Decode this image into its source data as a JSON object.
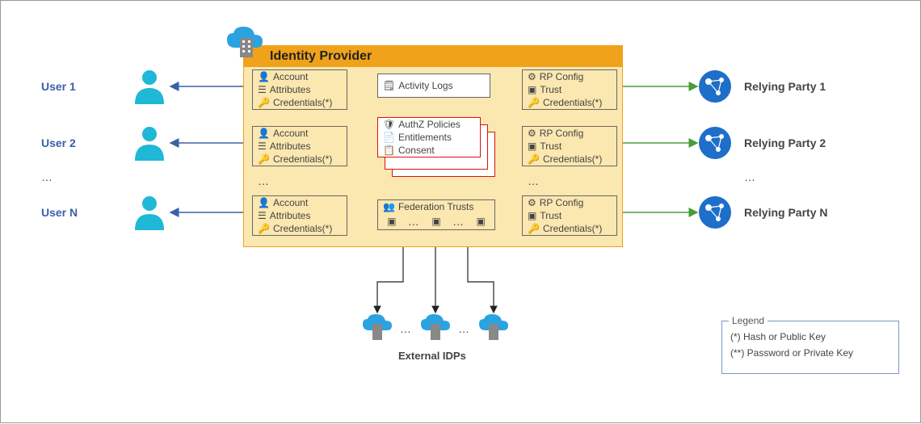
{
  "title": "Identity Provider",
  "users": [
    {
      "label": "User 1"
    },
    {
      "label": "User 2"
    },
    {
      "label": "User N"
    }
  ],
  "relying_parties": [
    {
      "label": "Relying Party 1"
    },
    {
      "label": "Relying Party 2"
    },
    {
      "label": "Relying Party N"
    }
  ],
  "account_card": {
    "account": "Account",
    "attributes": "Attributes",
    "credentials": "Credentials(*)"
  },
  "rp_config_card": {
    "config": "RP Config",
    "trust": "Trust",
    "credentials": "Credentials(*)"
  },
  "activity_logs": "Activity Logs",
  "authz_card": {
    "policies": "AuthZ Policies",
    "entitlements": "Entitlements",
    "consent": "Consent"
  },
  "federation_trusts": "Federation Trusts",
  "external_idps": "External IDPs",
  "ellipsis": "…",
  "legend": {
    "title": "Legend",
    "star": "(*) Hash or Public Key",
    "dstar": "(**) Password or Private Key"
  }
}
